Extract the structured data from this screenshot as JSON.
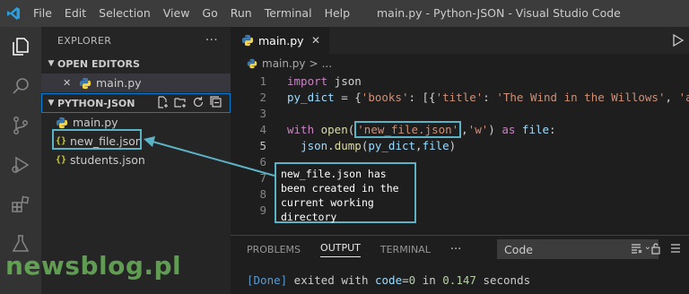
{
  "app": {
    "menu": [
      "File",
      "Edit",
      "Selection",
      "View",
      "Go",
      "Run",
      "Terminal",
      "Help"
    ],
    "window_title": "main.py - Python-JSON - Visual Studio Code"
  },
  "sidebar": {
    "title": "EXPLORER",
    "more": "···",
    "open_editors_label": "OPEN EDITORS",
    "open_editors": [
      {
        "close": "✕",
        "name": "main.py"
      }
    ],
    "project_label": "PYTHON-JSON",
    "files": [
      {
        "name": "main.py",
        "type": "python"
      },
      {
        "name": "new_file.json",
        "type": "json",
        "icon": "{}"
      },
      {
        "name": "students.json",
        "type": "json",
        "icon": "{}"
      }
    ]
  },
  "editor": {
    "tab_label": "main.py",
    "tab_close": "✕",
    "breadcrumb_file": "main.py",
    "breadcrumb_sep": ">",
    "breadcrumb_more": "...",
    "line_numbers": [
      "1",
      "2",
      "3",
      "4",
      "5",
      "6",
      "7",
      "8",
      "9"
    ],
    "current_line": "5",
    "code": {
      "l1_kw": "import",
      "l1_rest": " json",
      "l2_var": "py_dict",
      "l2_op": " = {",
      "l2_s1": "'books'",
      "l2_mid": ": [{",
      "l2_s2": "'title'",
      "l2_mid2": ": ",
      "l2_s3": "'The Wind in the Willows'",
      "l2_tail": ", ",
      "l2_s4": "'au",
      "l4_kw": "with",
      "l4_fn": " open",
      "l4_paren": "(",
      "l4_file": "'new_file.json'",
      "l4_comma": ",",
      "l4_mode": "'w'",
      "l4_close": ")",
      "l4_as": " as",
      "l4_var": " file",
      "l4_colon": ":",
      "l5_indent": "  ",
      "l5_mod": "json",
      "l5_dot": ".",
      "l5_fn": "dump",
      "l5_args_open": "(",
      "l5_arg1": "py_dict",
      "l5_comma": ",",
      "l5_arg2": "file",
      "l5_close": ")"
    }
  },
  "panel": {
    "tabs": [
      "PROBLEMS",
      "OUTPUT",
      "TERMINAL"
    ],
    "active_tab": "OUTPUT",
    "more": "···",
    "channel": "Code",
    "output": {
      "done": "[Done]",
      "text1": " exited with ",
      "code_label": "code",
      "eq": "=",
      "code_val": "0",
      "text2": " in ",
      "time": "0.147",
      "text3": " seconds"
    }
  },
  "annotation": {
    "callout_lines": [
      "new_file.json has",
      "been created in the",
      "current working",
      "directory"
    ]
  },
  "watermark": "newsblog.pl",
  "colors": {
    "accent": "#007fd4",
    "annotation": "#5cb3c6",
    "watermark": "#6bb35a"
  }
}
